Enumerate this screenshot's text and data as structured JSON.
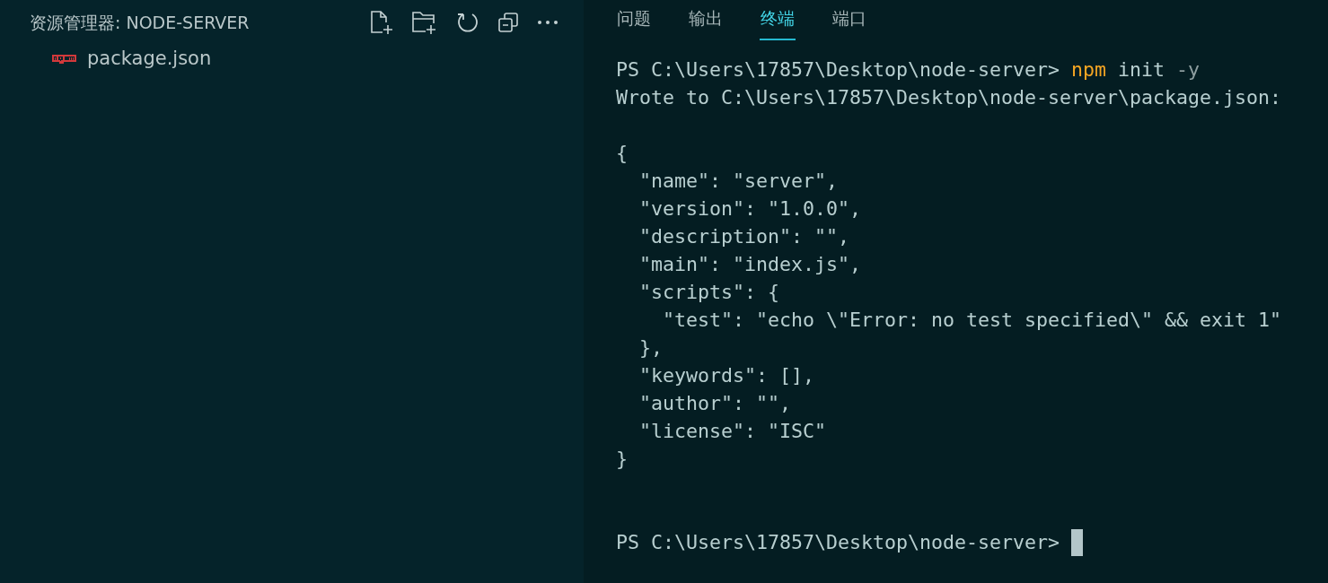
{
  "explorer": {
    "title": "资源管理器: NODE-SERVER",
    "files": [
      {
        "name": "package.json",
        "selected": false
      }
    ]
  },
  "panel_tabs": [
    {
      "label": "问题",
      "selected": false
    },
    {
      "label": "输出",
      "selected": false
    },
    {
      "label": "终端",
      "selected": true
    },
    {
      "label": "端口",
      "selected": false
    }
  ],
  "terminal": {
    "lines": [
      {
        "kind": "text",
        "segments": [
          {
            "kind": "plain",
            "text": "PS C:\\Users\\17857\\Desktop\\node-server> "
          },
          {
            "kind": "command",
            "text": "npm"
          },
          {
            "kind": "plain",
            "text": " init "
          },
          {
            "kind": "flag",
            "text": "-y"
          }
        ]
      },
      {
        "kind": "text",
        "segments": [
          {
            "kind": "plain",
            "text": "Wrote to C:\\Users\\17857\\Desktop\\node-server\\package.json:"
          }
        ]
      },
      {
        "kind": "blank"
      },
      {
        "kind": "text",
        "segments": [
          {
            "kind": "plain",
            "text": "{"
          }
        ]
      },
      {
        "kind": "text",
        "segments": [
          {
            "kind": "plain",
            "text": "  \"name\": \"server\","
          }
        ]
      },
      {
        "kind": "text",
        "segments": [
          {
            "kind": "plain",
            "text": "  \"version\": \"1.0.0\","
          }
        ]
      },
      {
        "kind": "text",
        "segments": [
          {
            "kind": "plain",
            "text": "  \"description\": \"\","
          }
        ]
      },
      {
        "kind": "text",
        "segments": [
          {
            "kind": "plain",
            "text": "  \"main\": \"index.js\","
          }
        ]
      },
      {
        "kind": "text",
        "segments": [
          {
            "kind": "plain",
            "text": "  \"scripts\": {"
          }
        ]
      },
      {
        "kind": "text",
        "segments": [
          {
            "kind": "plain",
            "text": "    \"test\": \"echo \\\"Error: no test specified\\\" && exit 1\""
          }
        ]
      },
      {
        "kind": "text",
        "segments": [
          {
            "kind": "plain",
            "text": "  },"
          }
        ]
      },
      {
        "kind": "text",
        "segments": [
          {
            "kind": "plain",
            "text": "  \"keywords\": [],"
          }
        ]
      },
      {
        "kind": "text",
        "segments": [
          {
            "kind": "plain",
            "text": "  \"author\": \"\","
          }
        ]
      },
      {
        "kind": "text",
        "segments": [
          {
            "kind": "plain",
            "text": "  \"license\": \"ISC\""
          }
        ]
      },
      {
        "kind": "text",
        "segments": [
          {
            "kind": "plain",
            "text": "}"
          }
        ]
      },
      {
        "kind": "blank"
      },
      {
        "kind": "blank"
      },
      {
        "kind": "text",
        "cursor": true,
        "segments": [
          {
            "kind": "plain",
            "text": "PS C:\\Users\\17857\\Desktop\\node-server> "
          }
        ]
      }
    ]
  }
}
